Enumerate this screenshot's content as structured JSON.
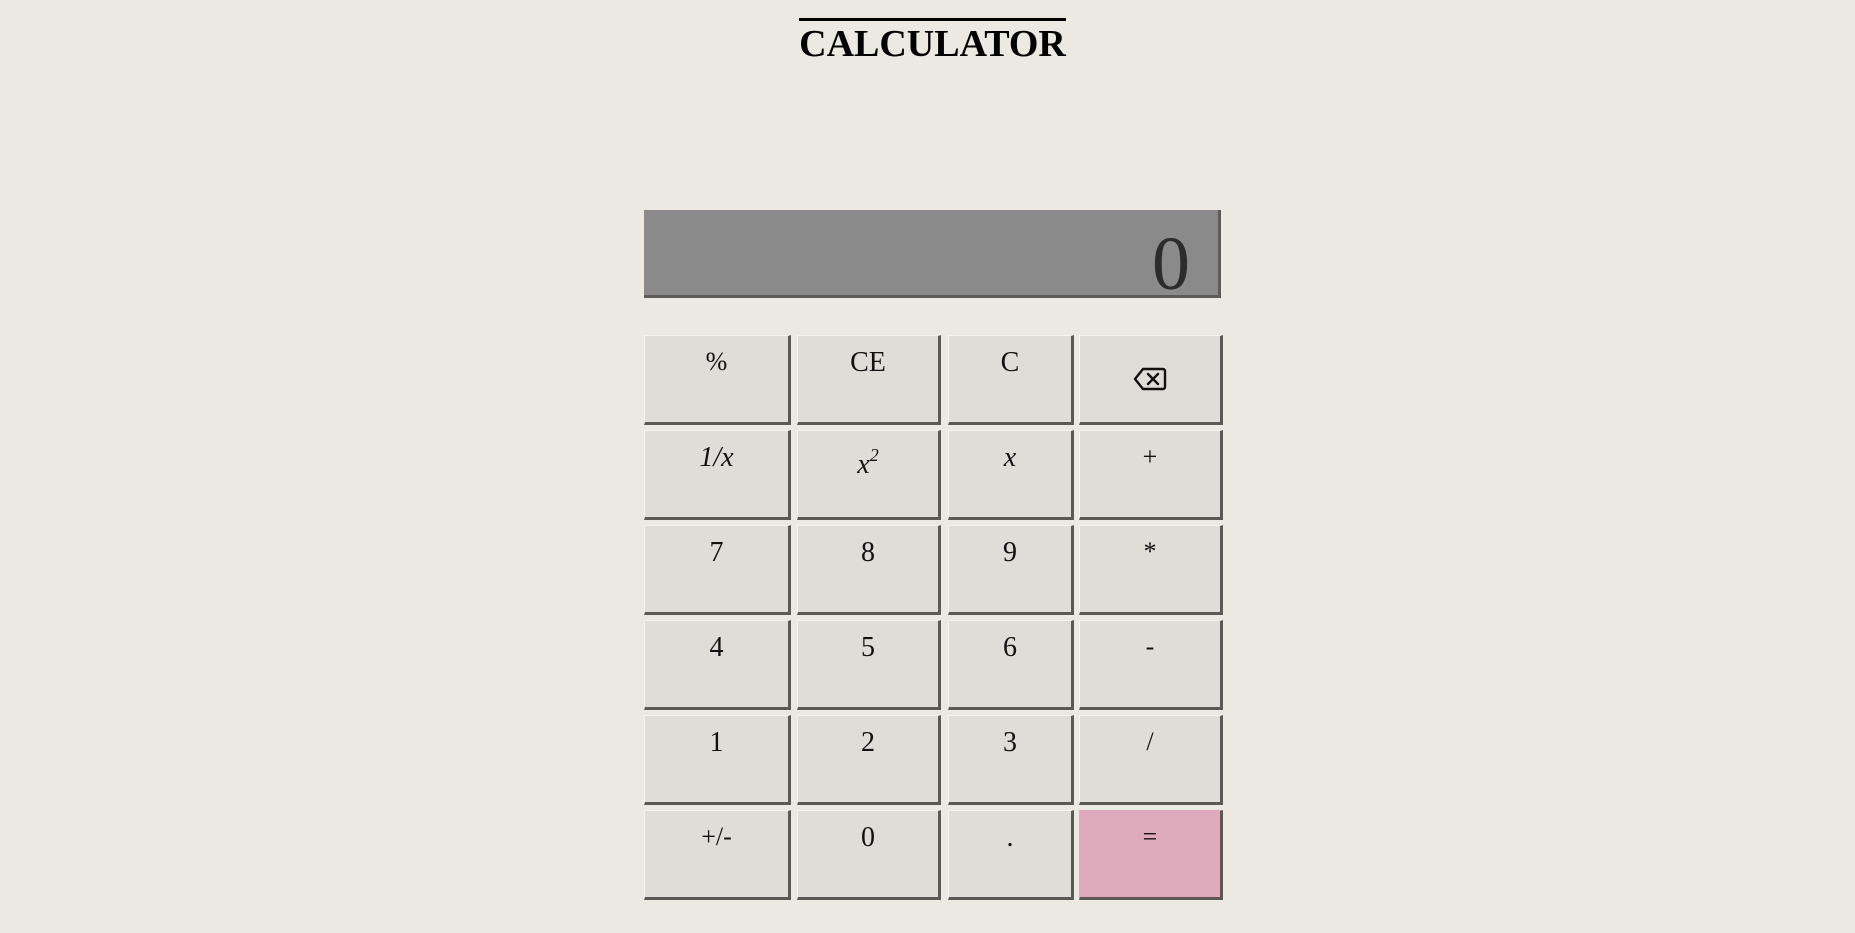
{
  "app": {
    "title": "CALCULATOR"
  },
  "display": {
    "value": "0"
  },
  "keys": {
    "percent": "%",
    "clear_entry": "CE",
    "clear": "C",
    "backspace_icon": "backspace-icon",
    "reciprocal": "1/x",
    "square_base": "x",
    "square_exp": "2",
    "x": "x",
    "plus": "+",
    "seven": "7",
    "eight": "8",
    "nine": "9",
    "multiply": "*",
    "four": "4",
    "five": "5",
    "six": "6",
    "minus": "-",
    "one": "1",
    "two": "2",
    "three": "3",
    "divide": "/",
    "negate": "+/-",
    "zero": "0",
    "decimal": ".",
    "equals": "="
  },
  "colors": {
    "background": "#ece8e2",
    "display": "#8a8a8a",
    "key": "#e0ddd8",
    "equals_key": "#dfaabc"
  }
}
